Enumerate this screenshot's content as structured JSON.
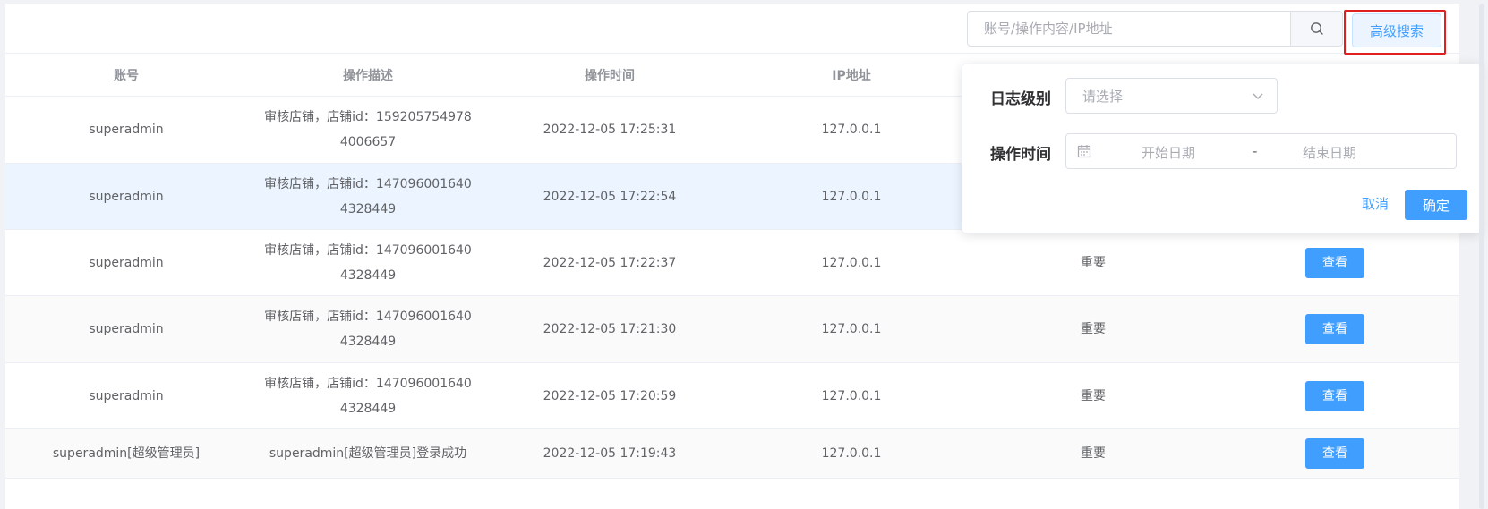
{
  "toolbar": {
    "search_placeholder": "账号/操作内容/IP地址",
    "search_icon": "search-icon",
    "advanced_search_label": "高级搜索"
  },
  "table": {
    "columns": [
      "账号",
      "操作描述",
      "操作时间",
      "IP地址"
    ],
    "rows": [
      {
        "account": "superadmin",
        "desc": "审核店铺，店铺id：1592057549784006657",
        "time": "2022-12-05 17:25:31",
        "ip": "127.0.0.1",
        "level": "",
        "action": ""
      },
      {
        "account": "superadmin",
        "desc": "审核店铺，店铺id：1470960016404328449",
        "time": "2022-12-05 17:22:54",
        "ip": "127.0.0.1",
        "level": "",
        "action": ""
      },
      {
        "account": "superadmin",
        "desc": "审核店铺，店铺id：1470960016404328449",
        "time": "2022-12-05 17:22:37",
        "ip": "127.0.0.1",
        "level": "重要",
        "action": "查看"
      },
      {
        "account": "superadmin",
        "desc": "审核店铺，店铺id：1470960016404328449",
        "time": "2022-12-05 17:21:30",
        "ip": "127.0.0.1",
        "level": "重要",
        "action": "查看"
      },
      {
        "account": "superadmin",
        "desc": "审核店铺，店铺id：1470960016404328449",
        "time": "2022-12-05 17:20:59",
        "ip": "127.0.0.1",
        "level": "重要",
        "action": "查看"
      },
      {
        "account": "superadmin[超级管理员]",
        "desc": "superadmin[超级管理员]登录成功",
        "time": "2022-12-05 17:19:43",
        "ip": "127.0.0.1",
        "level": "重要",
        "action": "查看"
      }
    ]
  },
  "advanced_popover": {
    "log_level_label": "日志级别",
    "log_level_placeholder": "请选择",
    "op_time_label": "操作时间",
    "start_placeholder": "开始日期",
    "range_separator": "-",
    "end_placeholder": "结束日期",
    "cancel_label": "取消",
    "confirm_label": "确定"
  },
  "colors": {
    "primary": "#409eff",
    "highlight_outline": "#e02020",
    "row_hover": "#ecf5ff"
  }
}
